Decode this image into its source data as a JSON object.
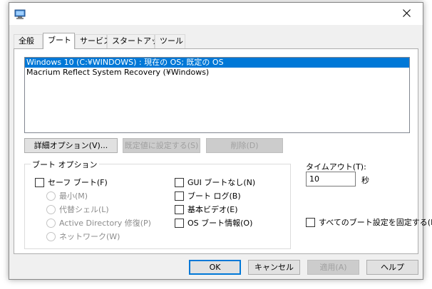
{
  "tabs": [
    {
      "label": "全般"
    },
    {
      "label": "ブート"
    },
    {
      "label": "サービス"
    },
    {
      "label": "スタートアップ"
    },
    {
      "label": "ツール"
    }
  ],
  "os_list": [
    {
      "label": "Windows 10 (C:¥WINDOWS) : 現在の OS; 既定の OS",
      "selected": true
    },
    {
      "label": "Macrium Reflect System Recovery (¥Windows)",
      "selected": false
    }
  ],
  "list_buttons": {
    "advanced": "詳細オプション(V)...",
    "set_default": "既定値に設定する(S)",
    "delete": "削除(D)"
  },
  "boot_options": {
    "title": "ブート オプション",
    "safe_boot": "セーフ ブート(F)",
    "minimal": "最小(M)",
    "alternate_shell": "代替シェル(L)",
    "active_directory": "Active Directory 修復(P)",
    "network": "ネットワーク(W)",
    "no_gui_boot": "GUI ブートなし(N)",
    "boot_log": "ブート ログ(B)",
    "base_video": "基本ビデオ(E)",
    "os_boot_info": "OS ブート情報(O)"
  },
  "timeout": {
    "label": "タイムアウト(T):",
    "value": "10",
    "unit": "秒"
  },
  "make_permanent": "すべてのブート設定を固定する(K)",
  "footer": {
    "ok": "OK",
    "cancel": "キャンセル",
    "apply": "適用(A)",
    "help": "ヘルプ"
  },
  "colors": {
    "selection": "#0078d7",
    "disabled_text": "#a0a0a0"
  }
}
